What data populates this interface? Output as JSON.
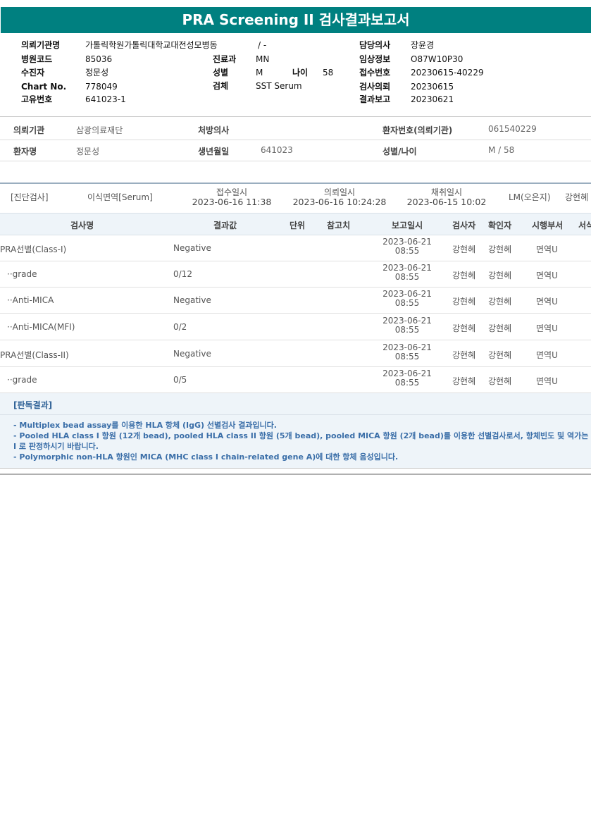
{
  "title": "PRA Screening II 검사결과보고서",
  "header": {
    "req_org_label": "의뢰기관명",
    "req_org_value": "가톨릭학원가톨릭대학교대전성모병동",
    "ward_value": "/ -",
    "doctor_label": "담당의사",
    "doctor_value": "장윤경",
    "hosp_code_label": "병원코드",
    "hosp_code_value": "85036",
    "dept_label": "진료과",
    "dept_value": "MN",
    "clinical_label": "임상정보",
    "clinical_value": "O87W10P30",
    "patient_label": "수진자",
    "patient_value": "정문성",
    "sex_label": "성별",
    "sex_value": "M",
    "age_label": "나이",
    "age_value": "58",
    "receipt_label": "접수번호",
    "receipt_value": "20230615-40229",
    "chart_label": "Chart No.",
    "chart_value": "778049",
    "specimen_label": "검체",
    "specimen_value": "SST Serum",
    "test_req_label": "검사의뢰",
    "test_req_value": "20230615",
    "unique_label": "고유번호",
    "unique_value": "641023-1",
    "result_report_label": "결과보고",
    "result_report_value": "20230621"
  },
  "info": {
    "org_label": "의뢰기관",
    "org_value": "삼광의료재단",
    "prescriber_label": "처방의사",
    "prescriber_value": "",
    "patient_no_label": "환자번호(의뢰기관)",
    "patient_no_value": "061540229",
    "name_label": "환자명",
    "name_value": "정문성",
    "dob_label": "생년월일",
    "dob_value": "641023",
    "sexage_label": "성별/나이",
    "sexage_value": "M / 58"
  },
  "summary": {
    "category": "[진단검사]",
    "subcategory": "이식면역[Serum]",
    "receipt_label": "접수일시",
    "receipt_value": "2023-06-16 11:38",
    "request_label": "의뢰일시",
    "request_value": "2023-06-16 10:24:28",
    "collect_label": "채취일시",
    "collect_value": "2023-06-15 10:02",
    "lm": "LM(오은지)",
    "reporter": "강현혜"
  },
  "columns": {
    "name": "검사명",
    "result": "결과값",
    "unit": "단위",
    "ref": "참고치",
    "report_date": "보고일시",
    "tester": "검사자",
    "confirmer": "확인자",
    "dept": "시행부서",
    "extra": "서식"
  },
  "rows": [
    {
      "name": "PRA선별(Class-I)",
      "result": "Negative",
      "date": "2023-06-21",
      "time": "08:55",
      "tester": "강현혜",
      "confirmer": "강현혜",
      "dept": "면역U"
    },
    {
      "name": "··grade",
      "result": "0/12",
      "date": "2023-06-21",
      "time": "08:55",
      "tester": "강현혜",
      "confirmer": "강현혜",
      "dept": "면역U"
    },
    {
      "name": "··Anti-MICA",
      "result": "Negative",
      "date": "2023-06-21",
      "time": "08:55",
      "tester": "강현혜",
      "confirmer": "강현혜",
      "dept": "면역U"
    },
    {
      "name": "··Anti-MICA(MFI)",
      "result": "0/2",
      "date": "2023-06-21",
      "time": "08:55",
      "tester": "강현혜",
      "confirmer": "강현혜",
      "dept": "면역U"
    },
    {
      "name": "PRA선별(Class-II)",
      "result": "Negative",
      "date": "2023-06-21",
      "time": "08:55",
      "tester": "강현혜",
      "confirmer": "강현혜",
      "dept": "면역U"
    },
    {
      "name": "··grade",
      "result": "0/5",
      "date": "2023-06-21",
      "time": "08:55",
      "tester": "강현혜",
      "confirmer": "강현혜",
      "dept": "면역U"
    }
  ],
  "judgement": {
    "label": "[판독결과]",
    "lines": [
      "- Multiplex bead assay를 이용한 HLA 항체 (IgG) 선별검사 결과입니다.",
      "- Pooled HLA class I 항원 (12개 bead), pooled HLA class II 항원 (5개 bead), pooled MICA 항원 (2개 bead)를 이용한 선별검사로서, 항체빈도 및 역가는 MF",
      "I 로 판정하시기 바랍니다.",
      "- Polymorphic non-HLA 항원인 MICA (MHC class I chain-related gene A)에 대한 항체 음성입니다."
    ]
  }
}
